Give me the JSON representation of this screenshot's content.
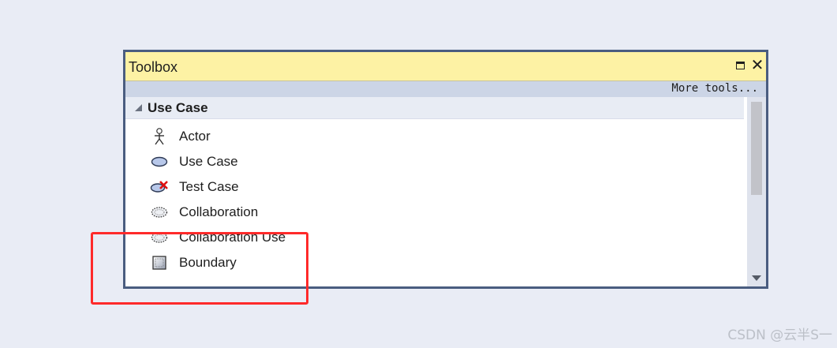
{
  "toolbox": {
    "title": "Toolbox",
    "more_tools": "More tools...",
    "group": "Use Case",
    "items": [
      {
        "label": "Actor",
        "icon": "actor-icon"
      },
      {
        "label": "Use Case",
        "icon": "use-case-icon"
      },
      {
        "label": "Test Case",
        "icon": "test-case-icon"
      },
      {
        "label": "Collaboration",
        "icon": "collaboration-icon"
      },
      {
        "label": "Collaboration Use",
        "icon": "collaboration-use-icon"
      },
      {
        "label": "Boundary",
        "icon": "boundary-icon"
      }
    ]
  },
  "watermark": "CSDN @云半S一",
  "colors": {
    "titlebar": "#fdf2a4",
    "border": "#4a5d80",
    "highlight": "#ff2a2a"
  }
}
